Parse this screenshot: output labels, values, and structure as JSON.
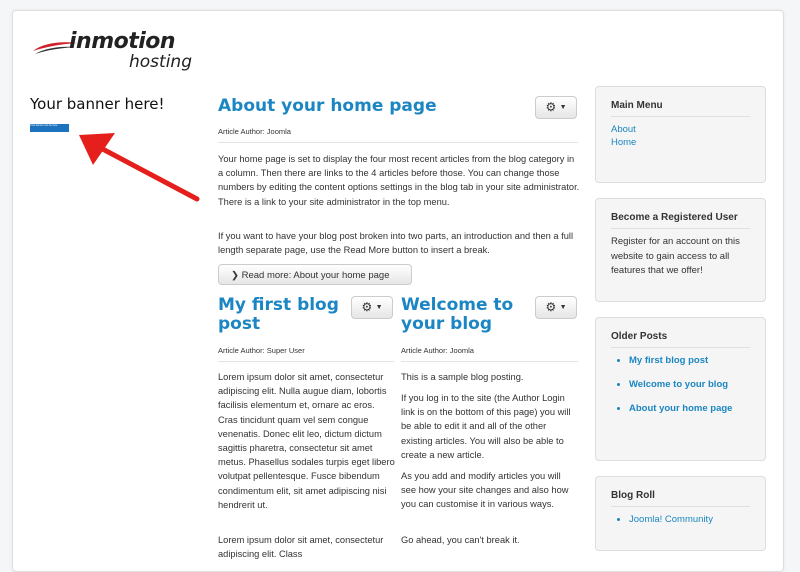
{
  "logo": {
    "main": "inmotion",
    "sub": "hosting"
  },
  "banner": {
    "title": "Your banner here!",
    "image_text": "Your banner can be here"
  },
  "articles": {
    "home": {
      "title": "About your home page",
      "author": "Article Author: Joomla",
      "p1": "Your home page is set to display the four most recent articles from the blog category in a column. Then there are links to the 4 articles before those. You can change those numbers by editing the content options settings in the blog tab in your site administrator. There is a link to your site administrator in the top menu.",
      "p2": "If you want to have your blog post broken into two parts, an introduction and then a full length separate page, use the Read More button to insert a break.",
      "readmore": "Read more: About your home page"
    },
    "first": {
      "title_line1": "My first blog",
      "title_line2": "post",
      "author": "Article Author: Super User",
      "p1": "Lorem ipsum dolor sit amet, consectetur adipiscing elit. Nulla augue diam, lobortis facilisis elementum et, ornare ac eros. Cras tincidunt quam vel sem congue venenatis. Donec elit leo, dictum dictum sagittis pharetra, consectetur sit amet metus. Phasellus sodales turpis eget libero volutpat pellentesque. Fusce bibendum condimentum elit, sit amet adipiscing nisi hendrerit ut.",
      "p2": "Lorem ipsum dolor sit amet, consectetur adipiscing elit. Class"
    },
    "welcome": {
      "title_line1": "Welcome to",
      "title_line2": "your blog",
      "author": "Article Author: Joomla",
      "p1": "This is a sample blog posting.",
      "p2": "If you log in to the site (the Author Login link is on the bottom of this page) you will be able to edit it and all of the other existing articles. You will also be able to create a new article.",
      "p3": "As you add and modify articles you will see how your site changes and also how you can customise it in various ways.",
      "p4": "Go ahead, you can't break it."
    }
  },
  "gear_icon": "gear-icon",
  "sidebar": {
    "main_menu": {
      "title": "Main Menu",
      "items": [
        "About",
        "Home"
      ]
    },
    "register": {
      "title": "Become a Registered User",
      "text": "Register for an account on this website to gain access to all features that we offer!"
    },
    "older_posts": {
      "title": "Older Posts",
      "items": [
        "My first blog post",
        "Welcome to your blog",
        "About your home page"
      ]
    },
    "blog_roll": {
      "title": "Blog Roll",
      "items": [
        "Joomla! Community"
      ]
    }
  },
  "colors": {
    "link": "#1b86c2",
    "arrow": "#e5201c",
    "banner": "#1e73be"
  }
}
